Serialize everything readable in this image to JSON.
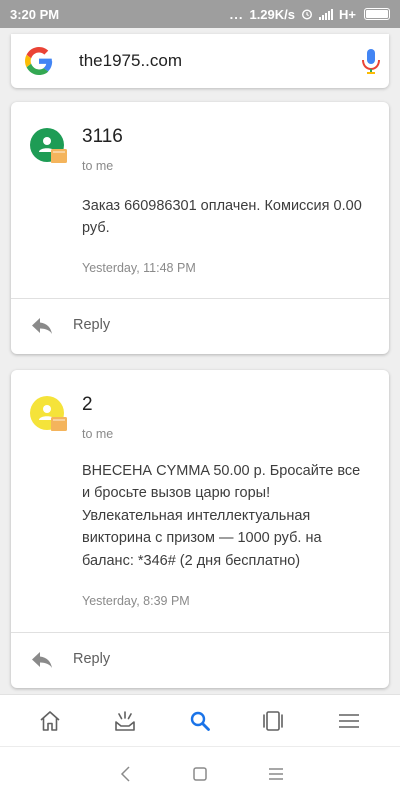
{
  "status_bar": {
    "time": "3:20 PM",
    "dots": "...",
    "network_speed": "1.29K/s",
    "network_type": "H+"
  },
  "search": {
    "query": "the1975..com"
  },
  "messages": [
    {
      "sender": "3116",
      "recipient": "to me",
      "body": "Заказ 660986301 оплачен.  Комиссия 0.00 руб.",
      "timestamp": "Yesterday, 11:48 PM",
      "avatar_color": "#1e9c55",
      "reply_label": "Reply"
    },
    {
      "sender": "2",
      "recipient": "to me",
      "body": "ВНЕСЕНА CYMMA 50.00 р. Бросайте все и бросьте вызов царю горы! Увлекательная интеллектуальная викторина с призом — 1000 руб. на баланс: *346# (2 дня бесплатно)",
      "timestamp": "Yesterday, 8:39 PM",
      "avatar_color": "#f5e33a",
      "reply_label": "Reply"
    }
  ],
  "bottom_nav": {
    "items": [
      {
        "icon": "home-icon"
      },
      {
        "icon": "updates-icon"
      },
      {
        "icon": "search-icon"
      },
      {
        "icon": "recents-icon"
      },
      {
        "icon": "menu-icon"
      }
    ],
    "active_color": "#1a73e8",
    "inactive_color": "#616161"
  },
  "system_nav": {
    "buttons": [
      {
        "icon": "back-icon"
      },
      {
        "icon": "home-square-icon"
      },
      {
        "icon": "recent-apps-icon"
      }
    ]
  },
  "colors": {
    "background": "#efefef",
    "status_bar": "#9e9e9e",
    "badge_orange": "#f4b45c"
  }
}
